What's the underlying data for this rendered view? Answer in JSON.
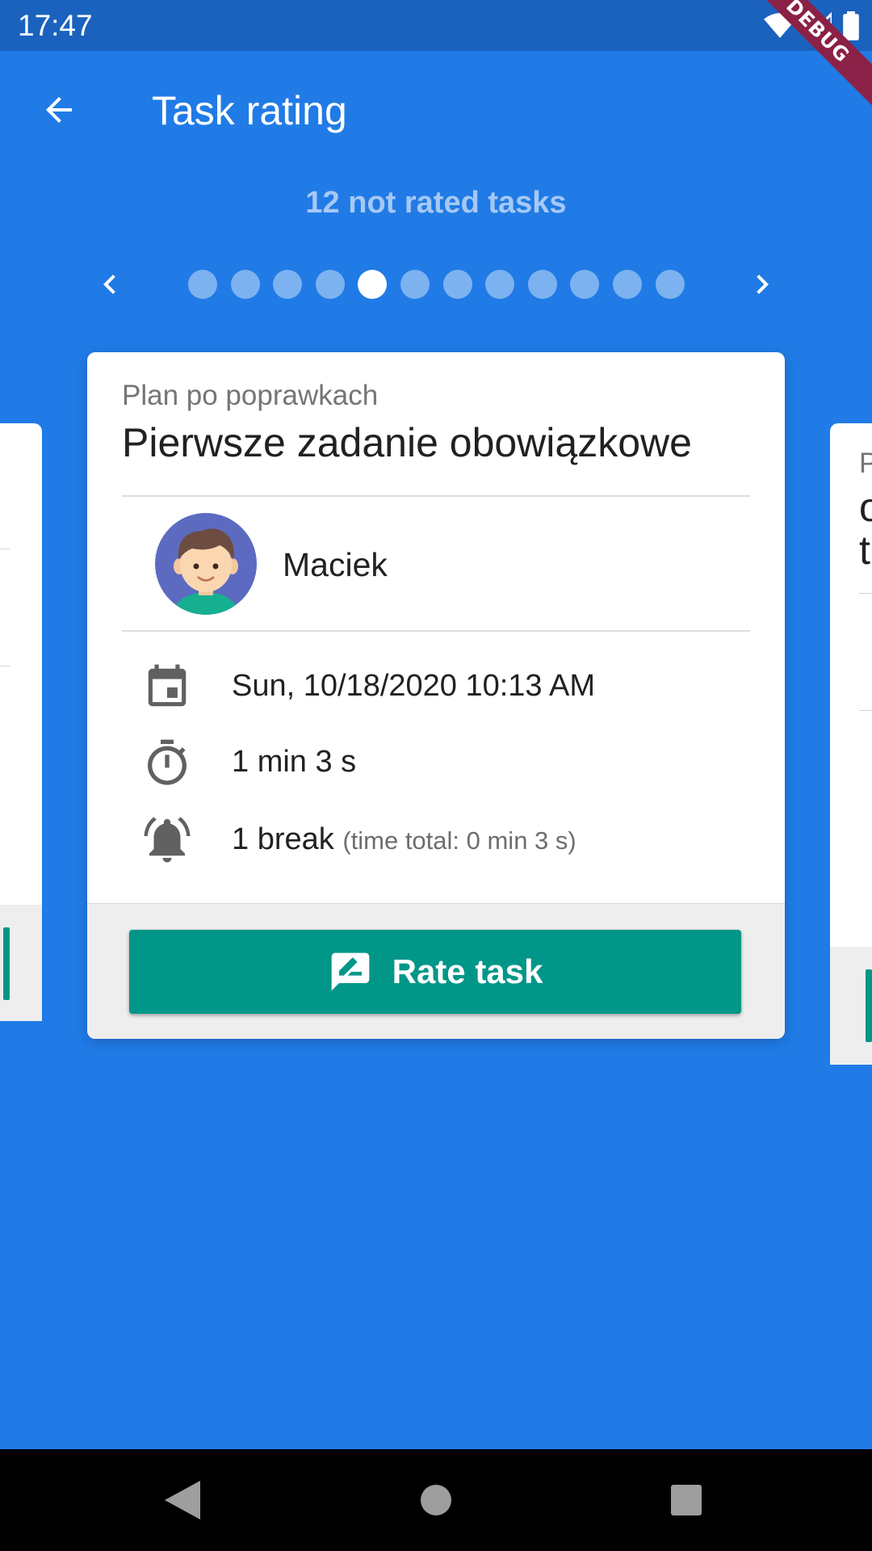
{
  "status_bar": {
    "time": "17:47",
    "icons": [
      "wifi-icon",
      "cell-signal-icon",
      "battery-icon"
    ],
    "debug_label": "DEBUG"
  },
  "app_bar": {
    "title": "Task rating",
    "back_icon": "arrow-back-icon"
  },
  "header": {
    "subtitle": "12 not rated tasks"
  },
  "pager": {
    "total": 12,
    "active_index": 4,
    "prev_icon": "chevron-left-icon",
    "next_icon": "chevron-right-icon"
  },
  "card": {
    "plan": "Plan po poprawkach",
    "title": "Pierwsze zadanie obowiązkowe",
    "user": {
      "name": "Maciek",
      "avatar": "boy-avatar"
    },
    "date": "Sun, 10/18/2020 10:13 AM",
    "duration": "1 min 3 s",
    "breaks": "1 break",
    "breaks_detail": "(time total: 0 min 3 s)",
    "rate_button": "Rate task"
  },
  "right_card_preview": {
    "letters": [
      "P",
      "o",
      "t"
    ]
  },
  "colors": {
    "background": "#207BE6",
    "status_bar": "#1A62BE",
    "accent_button": "#009688",
    "dot_inactive": "#7DB2F1",
    "dot_active": "#FFFFFF",
    "debug_ribbon": "#8B2146"
  },
  "nav_bar": {
    "icons": [
      "nav-back-icon",
      "nav-home-icon",
      "nav-recents-icon"
    ]
  }
}
